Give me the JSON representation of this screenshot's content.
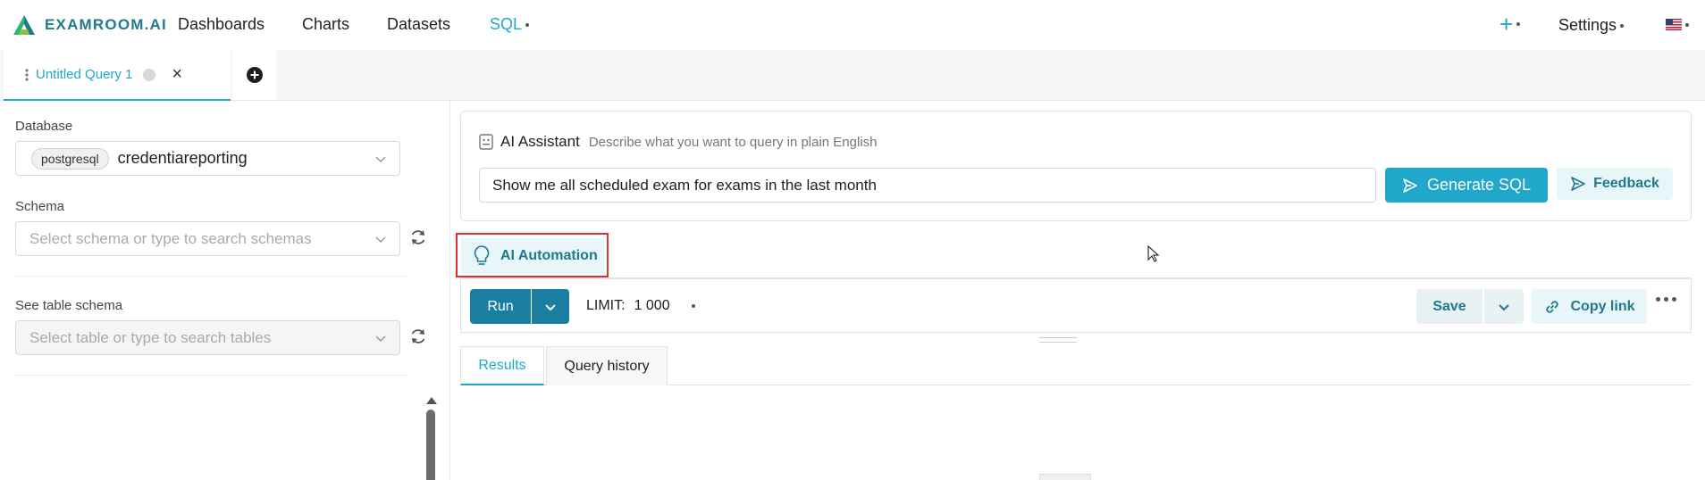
{
  "brand": {
    "name": "EXAMROOM.AI"
  },
  "nav": {
    "items": [
      "Dashboards",
      "Charts",
      "Datasets",
      "SQL"
    ],
    "settings": "Settings",
    "plus": "+"
  },
  "tabs": {
    "active_label": "Untitled Query 1",
    "close": "×"
  },
  "left_panel": {
    "database_label": "Database",
    "database_tag": "postgresql",
    "database_value": "credentiareporting",
    "schema_label": "Schema",
    "schema_placeholder": "Select schema or type to search schemas",
    "table_label": "See table schema",
    "table_placeholder": "Select table or type to search tables"
  },
  "ai_assistant": {
    "title": "AI Assistant",
    "description": "Describe what you want to query in plain English",
    "input_value": "Show me all scheduled exam for exams in the last month",
    "generate_label": "Generate SQL",
    "feedback_label": "Feedback"
  },
  "automation": {
    "label": "AI Automation"
  },
  "toolbar": {
    "run_label": "Run",
    "limit_label": "LIMIT:",
    "limit_value": "1 000",
    "save_label": "Save",
    "copy_link_label": "Copy link"
  },
  "result_tabs": [
    "Results",
    "Query history"
  ],
  "colors": {
    "accent": "#20a7c9",
    "brand": "#1f7a8c",
    "run": "#1a7ea0",
    "highlight_border": "#e03131"
  }
}
